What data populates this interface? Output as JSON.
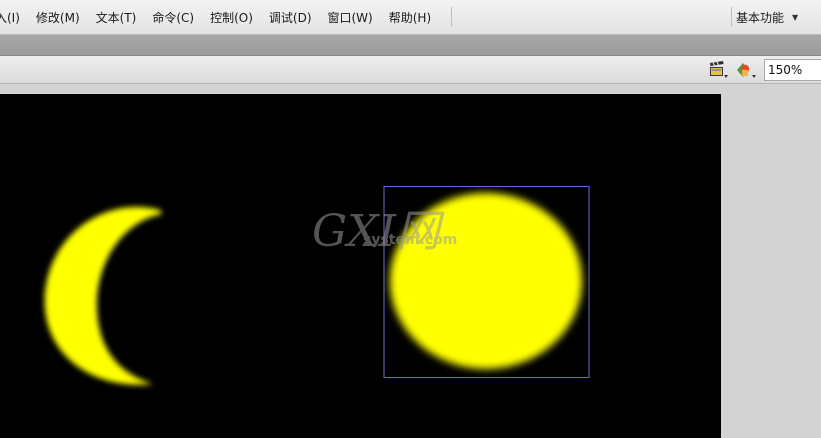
{
  "menu": {
    "items": [
      {
        "label": "入(I)",
        "name": "menu-insert"
      },
      {
        "label": "修改(M)",
        "name": "menu-modify"
      },
      {
        "label": "文本(T)",
        "name": "menu-text"
      },
      {
        "label": "命令(C)",
        "name": "menu-commands"
      },
      {
        "label": "控制(O)",
        "name": "menu-control"
      },
      {
        "label": "调试(D)",
        "name": "menu-debug"
      },
      {
        "label": "窗口(W)",
        "name": "menu-window"
      },
      {
        "label": "帮助(H)",
        "name": "menu-help"
      }
    ],
    "workspace_label": "基本功能",
    "workspace_arrow": "▼"
  },
  "editbar": {
    "scene_icon": "clapperboard-icon",
    "symbol_icon": "edit-symbols-icon",
    "zoom_value": "150%"
  },
  "stage": {
    "background": "#000000",
    "shape_color": "#ffff00",
    "selection_color": "#6a6ad0",
    "watermark": {
      "logo": "GXI网",
      "site": "system.com"
    }
  }
}
